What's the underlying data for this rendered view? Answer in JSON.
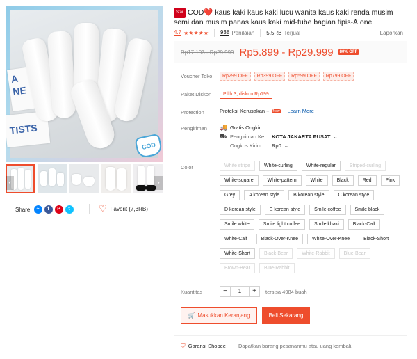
{
  "product": {
    "badge": "Star",
    "title": "COD❤️ kaus kaki kaus kaki lucu wanita kaus kaki renda musim semi dan musim panas kaus kaki mid-tube bagian tipis-A.one",
    "rating": "4.7",
    "reviews_count": "938",
    "reviews_label": "Penilaian",
    "sold_count": "5,5RB",
    "sold_label": "Terjual",
    "report_label": "Laporkan"
  },
  "price": {
    "original": "Rp17.103 - Rp29.999",
    "current": "Rp5.899 - Rp29.999",
    "discount": "80% OFF"
  },
  "gallery": {
    "main_cod_text": "COD",
    "book_text": "TISTS",
    "thumbnail_count": 5,
    "accent": "#ee4d2d"
  },
  "share": {
    "label": "Share:",
    "favorite_label": "Favorit (7,3RB)"
  },
  "labels": {
    "voucher": "Voucher Toko",
    "diskon": "Paket Diskon",
    "protection": "Protection",
    "shipping": "Pengiriman",
    "color": "Color",
    "quantity": "Kuantitas"
  },
  "vouchers": [
    "Rp299 OFF",
    "Rp399 OFF",
    "Rp599 OFF",
    "Rp799 OFF"
  ],
  "paket_diskon": "Pilih 3, diskon Rp199",
  "protection": {
    "text": "Proteksi Kerusakan +",
    "new_badge": "New",
    "learn_more": "Learn More"
  },
  "shipping": {
    "free": "Gratis Ongkir",
    "to_label": "Pengiriman Ke",
    "to_value": "KOTA JAKARTA PUSAT",
    "cost_label": "Ongkos Kirim",
    "cost_value": "Rp0"
  },
  "colors": [
    {
      "label": "White stripe",
      "disabled": true
    },
    {
      "label": "White-curling",
      "disabled": false
    },
    {
      "label": "White-regular",
      "disabled": false
    },
    {
      "label": "Striped-curling",
      "disabled": true
    },
    {
      "label": "White-square",
      "disabled": false
    },
    {
      "label": "White-pattern",
      "disabled": false
    },
    {
      "label": "White",
      "disabled": false
    },
    {
      "label": "Black",
      "disabled": false
    },
    {
      "label": "Red",
      "disabled": false
    },
    {
      "label": "Pink",
      "disabled": false
    },
    {
      "label": "Grey",
      "disabled": false
    },
    {
      "label": "A korean style",
      "disabled": false
    },
    {
      "label": "B korean style",
      "disabled": false
    },
    {
      "label": "C korean style",
      "disabled": false
    },
    {
      "label": "D korean style",
      "disabled": false
    },
    {
      "label": "E korean style",
      "disabled": false
    },
    {
      "label": "Smile coffee",
      "disabled": false
    },
    {
      "label": "Smile black",
      "disabled": false
    },
    {
      "label": "Smile white",
      "disabled": false
    },
    {
      "label": "Smile light coffee",
      "disabled": false
    },
    {
      "label": "Smile khaki",
      "disabled": false
    },
    {
      "label": "Black-Calf",
      "disabled": false
    },
    {
      "label": "White-Calf",
      "disabled": false
    },
    {
      "label": "Black-Over-Knee",
      "disabled": false
    },
    {
      "label": "White-Over-Knee",
      "disabled": false
    },
    {
      "label": "Black-Short",
      "disabled": false
    },
    {
      "label": "White-Short",
      "disabled": false
    },
    {
      "label": "Black-Bear",
      "disabled": true
    },
    {
      "label": "White-Rabbit",
      "disabled": true
    },
    {
      "label": "Blue-Bear",
      "disabled": true
    },
    {
      "label": "Brown-Bear",
      "disabled": true
    },
    {
      "label": "Blue-Rabbit",
      "disabled": true
    }
  ],
  "quantity": {
    "minus": "−",
    "value": "1",
    "plus": "+",
    "stock": "tersisa 4984 buah"
  },
  "actions": {
    "add_to_cart": "Masukkan Keranjang",
    "buy_now": "Beli Sekarang"
  },
  "guarantee": {
    "title": "Garansi Shopee",
    "desc": "Dapatkan barang pesananmu atau uang kembali."
  }
}
